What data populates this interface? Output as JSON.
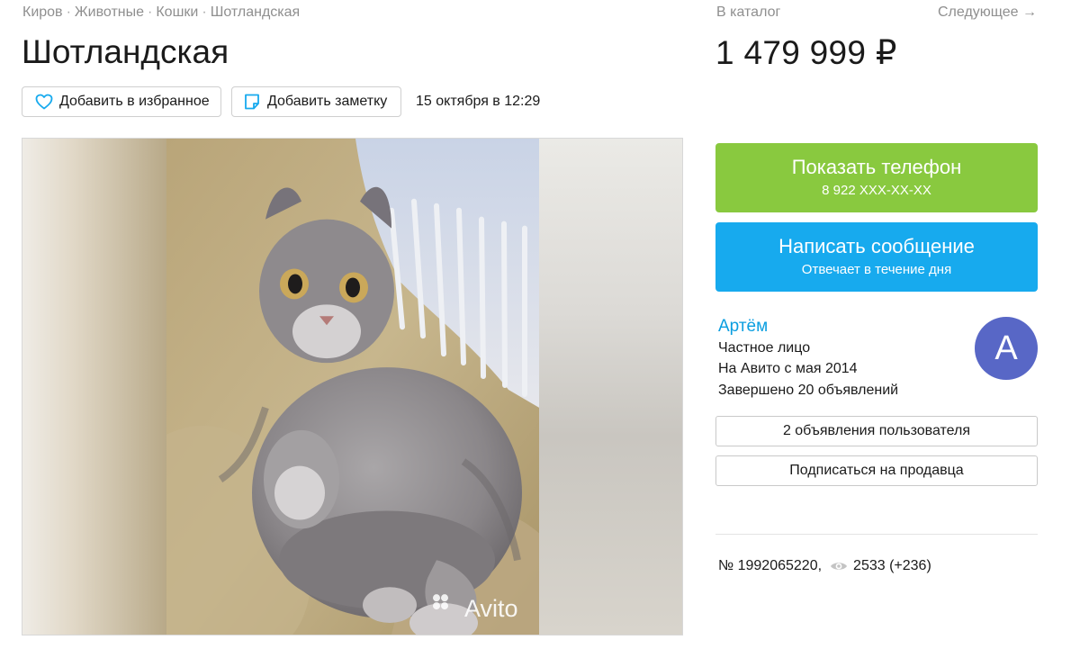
{
  "breadcrumbs": [
    "Киров",
    "Животные",
    "Кошки",
    "Шотландская"
  ],
  "breadcrumb_separator": "·",
  "title": "Шотландская",
  "price": "1 479 999 ₽",
  "nav": {
    "catalog": "В каталог",
    "next": "Следующее →"
  },
  "actions": {
    "favorite": "Добавить в избранное",
    "note": "Добавить заметку"
  },
  "published": "15 октября в 12:29",
  "watermark": "Avito",
  "contact": {
    "phone_label": "Показать телефон",
    "phone_masked": "8 922 XXX-XX-XX",
    "message_label": "Написать сообщение",
    "message_sub": "Отвечает в течение дня"
  },
  "seller": {
    "name": "Артём",
    "type": "Частное лицо",
    "since": "На Авито с мая 2014",
    "completed": "Завершено 20 объявлений",
    "avatar_letter": "А",
    "listings_button": "2 объявления пользователя",
    "subscribe_button": "Подписаться на продавца"
  },
  "item": {
    "number": "№ 1992065220,",
    "views": "2533 (+236)"
  },
  "colors": {
    "call": "#89c93f",
    "message": "#17aaee",
    "link": "#0a9ee0",
    "avatar": "#5867c6"
  }
}
